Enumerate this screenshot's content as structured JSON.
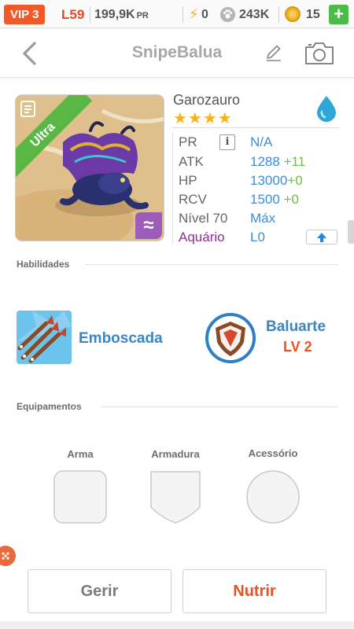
{
  "status": {
    "vip": "VIP 3",
    "level": "L59",
    "pr_value": "199,9K",
    "pr_unit": "PR",
    "energy": "0",
    "food": "243K",
    "gems": "15",
    "plus": "+"
  },
  "header": {
    "title": "SnipeBalua"
  },
  "monster": {
    "rarity": "Ultra",
    "name": "Garozauro",
    "stars": "★★★★",
    "element_badge": "≈",
    "stats": {
      "pr_label": "PR",
      "pr_value": "N/A",
      "atk_label": "ATK",
      "atk_value": "1288",
      "atk_bonus": "+11",
      "hp_label": "HP",
      "hp_value": "13000",
      "hp_bonus": "+0",
      "rcv_label": "RCV",
      "rcv_value": "1500",
      "rcv_bonus": "+0",
      "level_label": "Nível 70",
      "level_value": "Máx",
      "aquarium_label": "Aquário",
      "aquarium_value": "L0"
    }
  },
  "skills": {
    "heading": "Habilidades",
    "active_name": "Emboscada",
    "passive_name": "Baluarte",
    "passive_level": "LV 2"
  },
  "equipment": {
    "heading": "Equipamentos",
    "weapon_label": "Arma",
    "armor_label": "Armadura",
    "accessory_label": "Acessório"
  },
  "actions": {
    "manage_label": "Gerir",
    "feed_label": "Nutrir"
  },
  "colors": {
    "vip": "#f05a28",
    "accent_orange": "#e8531e",
    "stat_blue": "#3d8ed4",
    "bonus_green": "#6cc043",
    "ultra_green": "#5bb745",
    "aquarium_purple": "#8e2f95",
    "plus_green": "#4cbc48"
  },
  "icons": [
    "lightning-icon",
    "paw-icon",
    "gem-coin-icon",
    "back-chevron-icon",
    "pencil-icon",
    "camera-icon",
    "water-drop-icon",
    "info-icon",
    "upgrade-arrow-icon",
    "arrows-skill-icon",
    "shield-skill-icon"
  ]
}
